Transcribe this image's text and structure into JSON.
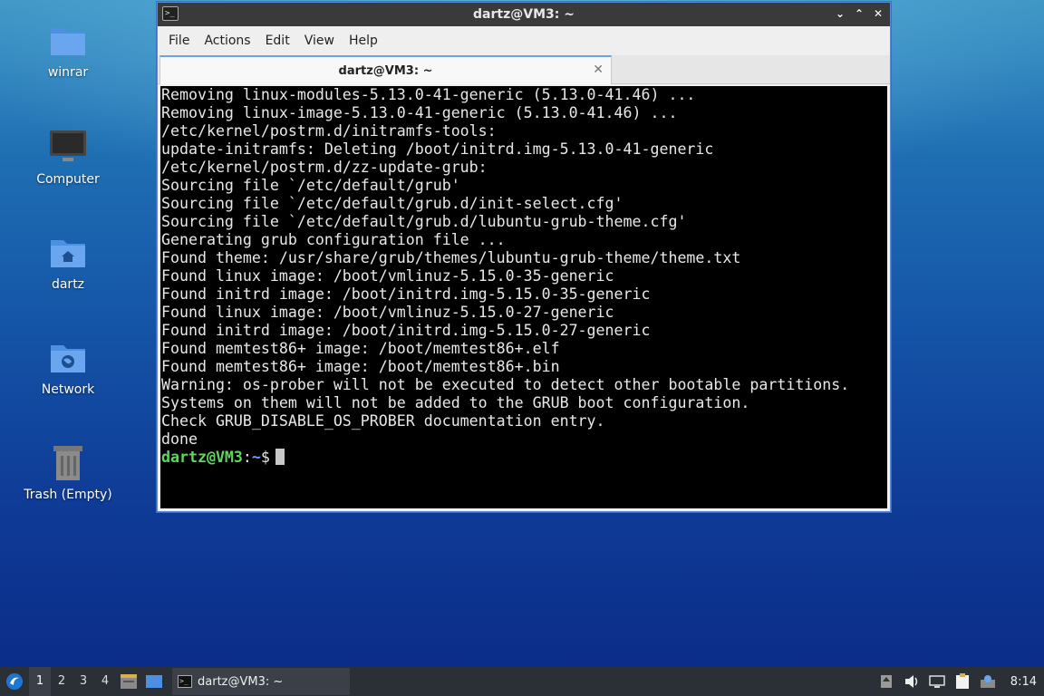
{
  "desktop": {
    "icons": [
      {
        "label": "winrar",
        "icon": "folder-icon"
      },
      {
        "label": "Computer",
        "icon": "computer-icon"
      },
      {
        "label": "dartz",
        "icon": "home-folder-icon"
      },
      {
        "label": "Network",
        "icon": "network-folder-icon"
      },
      {
        "label": "Trash (Empty)",
        "icon": "trash-icon"
      }
    ]
  },
  "window": {
    "title": "dartz@VM3: ~",
    "controls": {
      "minimize": "⌄",
      "maximize": "⌃",
      "close": "✕"
    },
    "menu": [
      "File",
      "Actions",
      "Edit",
      "View",
      "Help"
    ],
    "tab": {
      "label": "dartz@VM3: ~",
      "close": "✕"
    }
  },
  "terminal": {
    "lines": [
      "Removing linux-modules-5.13.0-41-generic (5.13.0-41.46) ...",
      "Removing linux-image-5.13.0-41-generic (5.13.0-41.46) ...",
      "/etc/kernel/postrm.d/initramfs-tools:",
      "update-initramfs: Deleting /boot/initrd.img-5.13.0-41-generic",
      "/etc/kernel/postrm.d/zz-update-grub:",
      "Sourcing file `/etc/default/grub'",
      "Sourcing file `/etc/default/grub.d/init-select.cfg'",
      "Sourcing file `/etc/default/grub.d/lubuntu-grub-theme.cfg'",
      "Generating grub configuration file ...",
      "Found theme: /usr/share/grub/themes/lubuntu-grub-theme/theme.txt",
      "Found linux image: /boot/vmlinuz-5.15.0-35-generic",
      "Found initrd image: /boot/initrd.img-5.15.0-35-generic",
      "Found linux image: /boot/vmlinuz-5.15.0-27-generic",
      "Found initrd image: /boot/initrd.img-5.15.0-27-generic",
      "Found memtest86+ image: /boot/memtest86+.elf",
      "Found memtest86+ image: /boot/memtest86+.bin",
      "Warning: os-prober will not be executed to detect other bootable partitions.",
      "Systems on them will not be added to the GRUB boot configuration.",
      "Check GRUB_DISABLE_OS_PROBER documentation entry.",
      "done"
    ],
    "prompt": {
      "user_host": "dartz@VM3",
      "sep": ":",
      "path": "~",
      "symbol": "$"
    }
  },
  "taskbar": {
    "workspaces": [
      "1",
      "2",
      "3",
      "4"
    ],
    "active_workspace": "1",
    "task": {
      "label": "dartz@VM3: ~"
    },
    "clock": "8:14"
  }
}
